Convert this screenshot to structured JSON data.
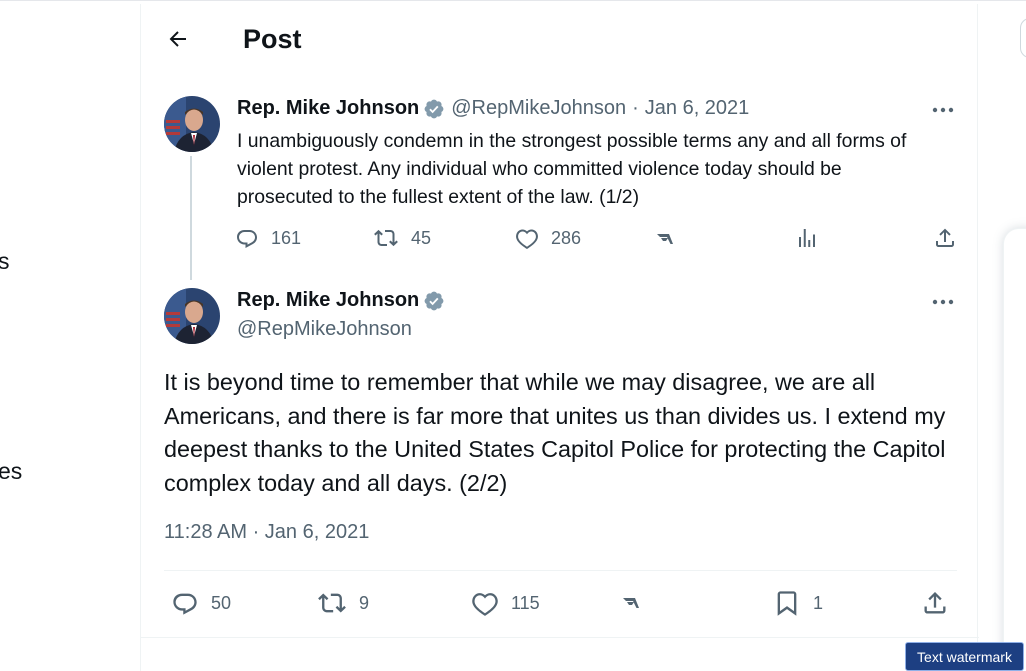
{
  "header": {
    "title": "Post"
  },
  "left_nav": {
    "fragment_1": "s",
    "fragment_2": "es"
  },
  "tweet1": {
    "author": "Rep. Mike Johnson",
    "handle": "@RepMikeJohnson",
    "separator": "·",
    "date": "Jan 6, 2021",
    "text": "I unambiguously condemn in the strongest possible terms any and all forms of violent protest. Any individual who committed violence today should be prosecuted to the fullest extent of the law. (1/2)",
    "replies": "161",
    "reposts": "45",
    "likes": "286"
  },
  "tweet2": {
    "author": "Rep. Mike Johnson",
    "handle": "@RepMikeJohnson",
    "text": "It is beyond time to remember that while we may disagree, we are all Americans, and there is far more that unites us than divides us. I extend my deepest thanks to the United States Capitol Police for protecting the Capitol complex today and all days. (2/2)",
    "timestamp": "11:28 AM · Jan 6, 2021",
    "replies": "50",
    "reposts": "9",
    "likes": "115",
    "bookmarks": "1"
  },
  "watermark": "Text watermark",
  "colors": {
    "text_primary": "#0f1419",
    "text_secondary": "#536471",
    "verified_badge": "#829aab",
    "divider": "#eff3f4",
    "watermark_bg": "#1d3f82"
  },
  "icons": [
    "back-arrow-icon",
    "verified-badge-icon",
    "more-icon",
    "reply-icon",
    "repost-icon",
    "like-icon",
    "grok-icon",
    "analytics-icon",
    "bookmark-icon",
    "share-icon"
  ]
}
